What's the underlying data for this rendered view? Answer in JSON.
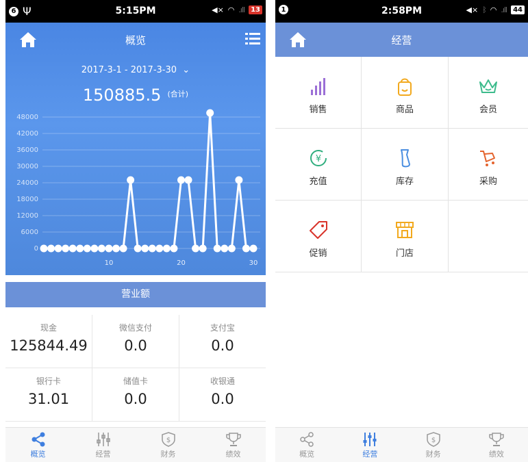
{
  "left": {
    "status": {
      "time": "5:15PM",
      "notif": "6",
      "battery": "13"
    },
    "header": {
      "title": "概览"
    },
    "date_range": "2017-3-1  -  2017-3-30",
    "total": {
      "value": "150885.5",
      "label": "(合计)"
    },
    "revenue_bar": "营业额",
    "stats": [
      [
        {
          "label": "现金",
          "value": "125844.49"
        },
        {
          "label": "微信支付",
          "value": "0.0"
        },
        {
          "label": "支付宝",
          "value": "0.0"
        }
      ],
      [
        {
          "label": "银行卡",
          "value": "31.01"
        },
        {
          "label": "储值卡",
          "value": "0.0"
        },
        {
          "label": "收银通",
          "value": "0.0"
        }
      ]
    ],
    "tabs": [
      {
        "label": "概览",
        "icon": "share-icon"
      },
      {
        "label": "经营",
        "icon": "sliders-icon"
      },
      {
        "label": "财务",
        "icon": "money-shield-icon"
      },
      {
        "label": "绩效",
        "icon": "trophy-icon"
      }
    ],
    "active_tab": 0
  },
  "right": {
    "status": {
      "time": "2:58PM",
      "notif": "1",
      "battery": "44"
    },
    "header": {
      "title": "经营"
    },
    "grid": [
      {
        "label": "销售",
        "icon": "bar-chart-icon",
        "color": "#9b6fd6"
      },
      {
        "label": "商品",
        "icon": "bag-icon",
        "color": "#f2a91e"
      },
      {
        "label": "会员",
        "icon": "crown-icon",
        "color": "#3dbb8c"
      },
      {
        "label": "充值",
        "icon": "yuan-refresh-icon",
        "color": "#2fae7e"
      },
      {
        "label": "库存",
        "icon": "boot-icon",
        "color": "#4a8ee0"
      },
      {
        "label": "采购",
        "icon": "cart-icon",
        "color": "#e4632d"
      },
      {
        "label": "促销",
        "icon": "tag-icon",
        "color": "#d9342b"
      },
      {
        "label": "门店",
        "icon": "store-icon",
        "color": "#f2a91e"
      }
    ],
    "tabs": [
      {
        "label": "概览",
        "icon": "share-icon"
      },
      {
        "label": "经营",
        "icon": "sliders-icon"
      },
      {
        "label": "财务",
        "icon": "money-shield-icon"
      },
      {
        "label": "绩效",
        "icon": "trophy-icon"
      }
    ],
    "active_tab": 1
  },
  "colors": {
    "accent": "#3f7fdf",
    "header": "#6b91d8"
  },
  "chart_data": {
    "type": "line",
    "x": [
      1,
      2,
      3,
      4,
      5,
      6,
      7,
      8,
      9,
      10,
      11,
      12,
      13,
      14,
      15,
      16,
      17,
      18,
      19,
      20,
      21,
      22,
      23,
      24,
      25,
      26,
      27,
      28,
      29,
      30
    ],
    "series": [
      {
        "values": [
          0,
          0,
          0,
          0,
          0,
          0,
          0,
          0,
          0,
          0,
          0,
          0,
          25000,
          0,
          0,
          0,
          0,
          0,
          0,
          25000,
          25000,
          0,
          0,
          49500,
          0,
          0,
          0,
          25000,
          0,
          0
        ]
      }
    ],
    "yticks": [
      0,
      6000,
      12000,
      18000,
      24000,
      30000,
      36000,
      42000,
      48000
    ],
    "xticks": [
      10,
      20,
      30
    ],
    "ylim": [
      0,
      50000
    ],
    "xlim": [
      1,
      30
    ],
    "grid": true
  }
}
